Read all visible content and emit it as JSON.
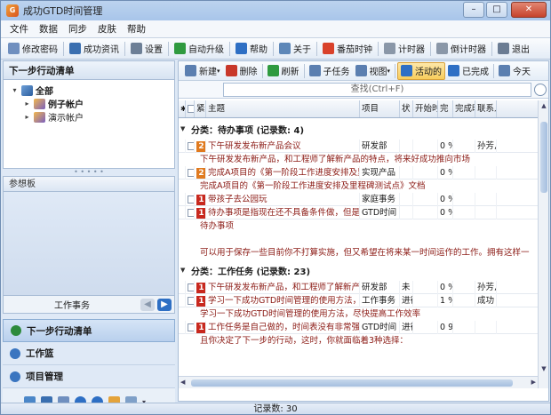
{
  "window": {
    "title": "成功GTD时间管理"
  },
  "menu": [
    "文件",
    "数据",
    "同步",
    "皮肤",
    "帮助"
  ],
  "toolbar": [
    {
      "name": "password",
      "label": "修改密码",
      "color": "#6f8fbf"
    },
    {
      "name": "news",
      "label": "成功资讯",
      "color": "#3a6fb0"
    },
    {
      "name": "settings",
      "label": "设置",
      "color": "#6d7f96"
    },
    {
      "name": "autoupgrade",
      "label": "自动升级",
      "color": "#2f9a3f"
    },
    {
      "name": "help",
      "label": "帮助",
      "color": "#2e6fc4"
    },
    {
      "name": "about",
      "label": "关于",
      "color": "#5d87b8"
    },
    {
      "name": "tomato",
      "label": "番茄时钟",
      "color": "#d9412a"
    },
    {
      "name": "timer",
      "label": "计时器",
      "color": "#8a97a8"
    },
    {
      "name": "countdown",
      "label": "倒计时器",
      "color": "#8a97a8"
    },
    {
      "name": "exit",
      "label": "退出",
      "color": "#6b7c93"
    }
  ],
  "left": {
    "heading": "下一步行动清单",
    "tree": {
      "root": "全部",
      "children": [
        "例子帐户",
        "演示帐户"
      ]
    },
    "notes_title": "参想板",
    "notes_footer": "工作事务",
    "nav": [
      {
        "label": "下一步行动清单",
        "color": "#2d8a3b"
      },
      {
        "label": "工作篮",
        "color": "#3a75c0"
      },
      {
        "label": "项目管理",
        "color": "#3a75c0"
      }
    ]
  },
  "right": {
    "toolbar": [
      {
        "name": "new",
        "label": "新建",
        "color": "#5b7fb0",
        "dropdown": true
      },
      {
        "name": "delete",
        "label": "删除",
        "color": "#c8382a"
      },
      {
        "name": "refresh",
        "label": "刷新",
        "color": "#2f9a3f"
      },
      {
        "name": "subtask",
        "label": "子任务",
        "color": "#5b7fb0"
      },
      {
        "name": "view",
        "label": "视图",
        "color": "#5b7fb0",
        "dropdown": true
      },
      {
        "name": "active",
        "label": "活动的",
        "color": "#2e6fc4",
        "active": true
      },
      {
        "name": "completed",
        "label": "已完成",
        "color": "#2e6fc4"
      },
      {
        "name": "today",
        "label": "今天",
        "color": "#5b7fb0"
      }
    ],
    "search_placeholder": "查找(Ctrl+F)",
    "columns": [
      "",
      "紧",
      "主题",
      "项目",
      "状",
      "开始时",
      "完",
      "完成时",
      "联系人"
    ],
    "groups": [
      {
        "label": "分类：待办事项 (记录数: 4)",
        "rows": [
          {
            "priority": "2",
            "pcolor": "#e07a1f",
            "subject": "下午研发发布新产品会议",
            "project": "研发部",
            "status": "",
            "start": "",
            "pct": "0 %",
            "end": "",
            "contact": "孙芳,",
            "desc": [
              "下午研发发布新产品，和工程师了解新产品的特点，将来好成功推向市场"
            ]
          },
          {
            "priority": "2",
            "pcolor": "#e07a1f",
            "subject": "完成A项目的《第一阶段工作进度安排及里程碑",
            "project": "实现产品",
            "status": "",
            "start": "",
            "pct": "0 %",
            "end": "",
            "contact": "",
            "desc": [
              "完成A项目的《第一阶段工作进度安排及里程碑测试点》文档"
            ]
          },
          {
            "priority": "1",
            "pcolor": "#c8281e",
            "subject": "带孩子去公园玩",
            "project": "家庭事务",
            "status": "",
            "start": "",
            "pct": "0 %",
            "end": "",
            "contact": "",
            "desc": []
          },
          {
            "priority": "1",
            "pcolor": "#c8281e",
            "subject": "待办事项是指现在还不具备条件做，但是可以推",
            "project": "GTD时间",
            "status": "",
            "start": "",
            "pct": "0 %",
            "end": "",
            "contact": "",
            "desc": [
              "待办事项",
              "",
              "可以用于保存一些目前你不打算实施，但又希望在将来某一时间运作的工作。拥有这样一"
            ]
          }
        ]
      },
      {
        "label": "分类：工作任务 (记录数: 23)",
        "rows": [
          {
            "priority": "1",
            "pcolor": "#c8281e",
            "subject": "下午研发发布新产品，和工程师了解新产品的",
            "project": "研发部",
            "status": "未",
            "start": "",
            "pct": "0 %",
            "end": "",
            "contact": "孙芳,",
            "desc": []
          },
          {
            "priority": "1",
            "pcolor": "#c8281e",
            "subject": "学习一下成功GTD时间管理的使用方法，尽快",
            "project": "工作事务",
            "status": "进行",
            "start": "",
            "pct": "1 %",
            "end": "",
            "contact": "成功",
            "desc": [
              "学习一下成功GTD时间管理的使用方法，尽快提高工作效率"
            ]
          },
          {
            "priority": "1",
            "pcolor": "#c8281e",
            "subject": "工作任务是自己做的，时间表没有非常强的要",
            "project": "GTD时间",
            "status": "进行",
            "start": "",
            "pct": "0 9",
            "end": "",
            "contact": "",
            "desc": [
              "且你决定了下一步的行动，这时，你就面临着3种选择："
            ]
          }
        ]
      }
    ]
  },
  "status": "记录数: 30"
}
